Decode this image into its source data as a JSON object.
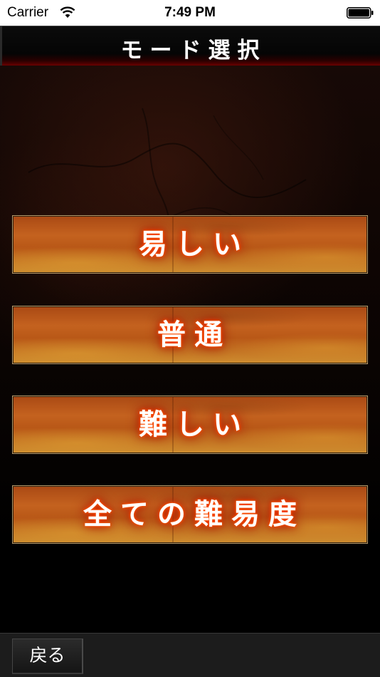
{
  "status_bar": {
    "carrier": "Carrier",
    "time": "7:49 PM",
    "wifi_icon": "wifi-icon",
    "battery_icon": "battery-icon"
  },
  "nav": {
    "title": "モード選択"
  },
  "modes": [
    {
      "label": "易しい"
    },
    {
      "label": "普通"
    },
    {
      "label": "難しい"
    },
    {
      "label": "全ての難易度"
    }
  ],
  "toolbar": {
    "back_label": "戻る"
  },
  "colors": {
    "button_orange": "#c4621f",
    "button_border": "#b79a6a",
    "text_glow": "#ff3a00",
    "nav_accent": "#6a0000"
  }
}
